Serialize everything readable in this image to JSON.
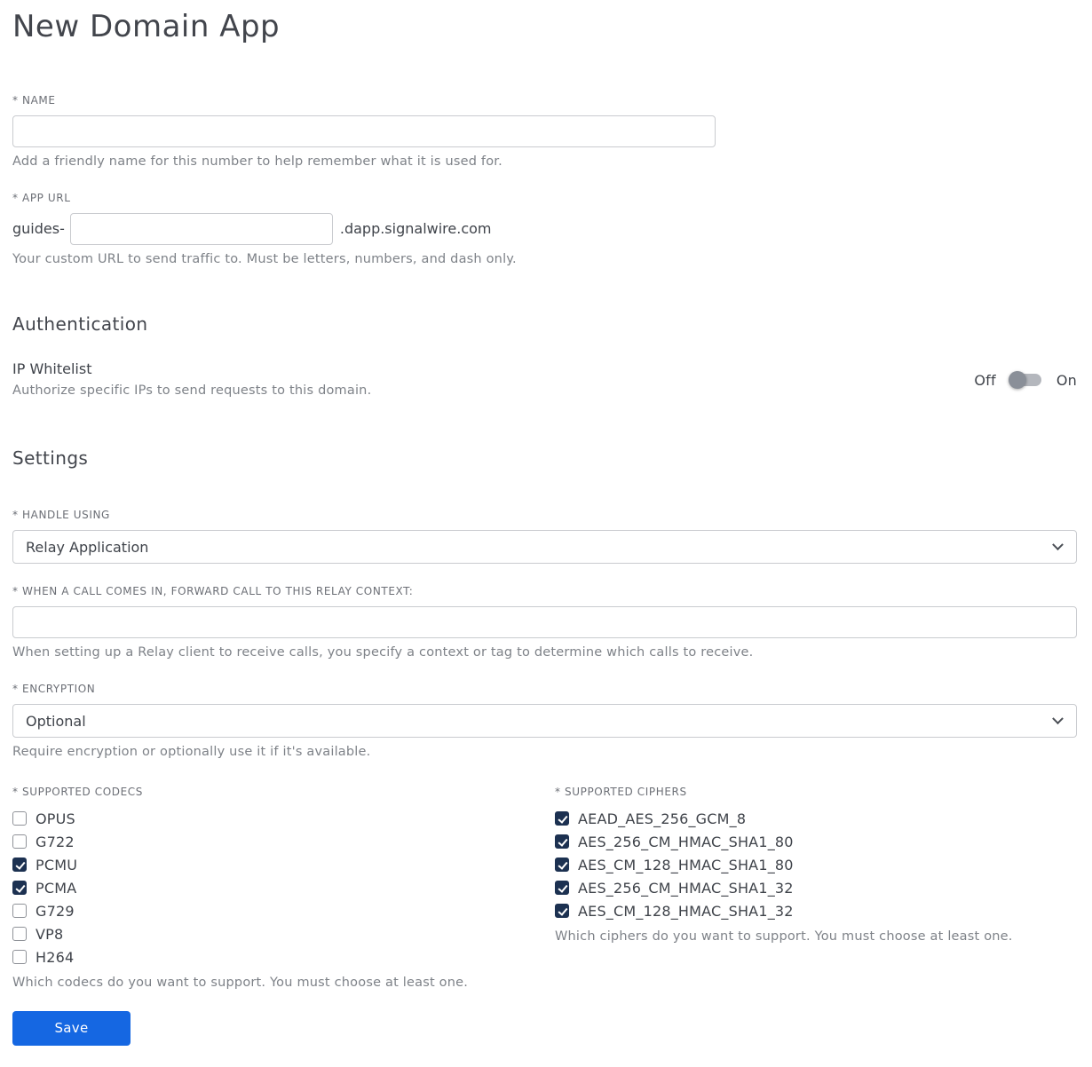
{
  "page": {
    "title": "New Domain App"
  },
  "name_field": {
    "label": "* NAME",
    "value": "",
    "help": "Add a friendly name for this number to help remember what it is used for."
  },
  "app_url_field": {
    "label": "* APP URL",
    "prefix": "guides-",
    "value": "",
    "suffix": ".dapp.signalwire.com",
    "help": "Your custom URL to send traffic to. Must be letters, numbers, and dash only."
  },
  "authentication": {
    "heading": "Authentication",
    "ip_whitelist": {
      "label": "IP Whitelist",
      "help": "Authorize specific IPs to send requests to this domain.",
      "off_label": "Off",
      "on_label": "On",
      "state": "off"
    }
  },
  "settings": {
    "heading": "Settings",
    "handle_using": {
      "label": "* HANDLE USING",
      "selected": "Relay Application"
    },
    "relay_context": {
      "label": "* WHEN A CALL COMES IN, FORWARD CALL TO THIS RELAY CONTEXT:",
      "value": "",
      "help": "When setting up a Relay client to receive calls, you specify a context or tag to determine which calls to receive."
    },
    "encryption": {
      "label": "* ENCRYPTION",
      "selected": "Optional",
      "help": "Require encryption or optionally use it if it's available."
    },
    "codecs": {
      "label": "* SUPPORTED CODECS",
      "items": [
        {
          "label": "OPUS",
          "checked": false
        },
        {
          "label": "G722",
          "checked": false
        },
        {
          "label": "PCMU",
          "checked": true
        },
        {
          "label": "PCMA",
          "checked": true
        },
        {
          "label": "G729",
          "checked": false
        },
        {
          "label": "VP8",
          "checked": false
        },
        {
          "label": "H264",
          "checked": false
        }
      ],
      "help": "Which codecs do you want to support. You must choose at least one."
    },
    "ciphers": {
      "label": "* SUPPORTED CIPHERS",
      "items": [
        {
          "label": "AEAD_AES_256_GCM_8",
          "checked": true
        },
        {
          "label": "AES_256_CM_HMAC_SHA1_80",
          "checked": true
        },
        {
          "label": "AES_CM_128_HMAC_SHA1_80",
          "checked": true
        },
        {
          "label": "AES_256_CM_HMAC_SHA1_32",
          "checked": true
        },
        {
          "label": "AES_CM_128_HMAC_SHA1_32",
          "checked": true
        }
      ],
      "help": "Which ciphers do you want to support. You must choose at least one."
    }
  },
  "actions": {
    "save_label": "Save"
  },
  "colors": {
    "primary_button": "#1567e2",
    "checkbox_checked": "#1c3151",
    "input_border": "#c9cbcf"
  }
}
